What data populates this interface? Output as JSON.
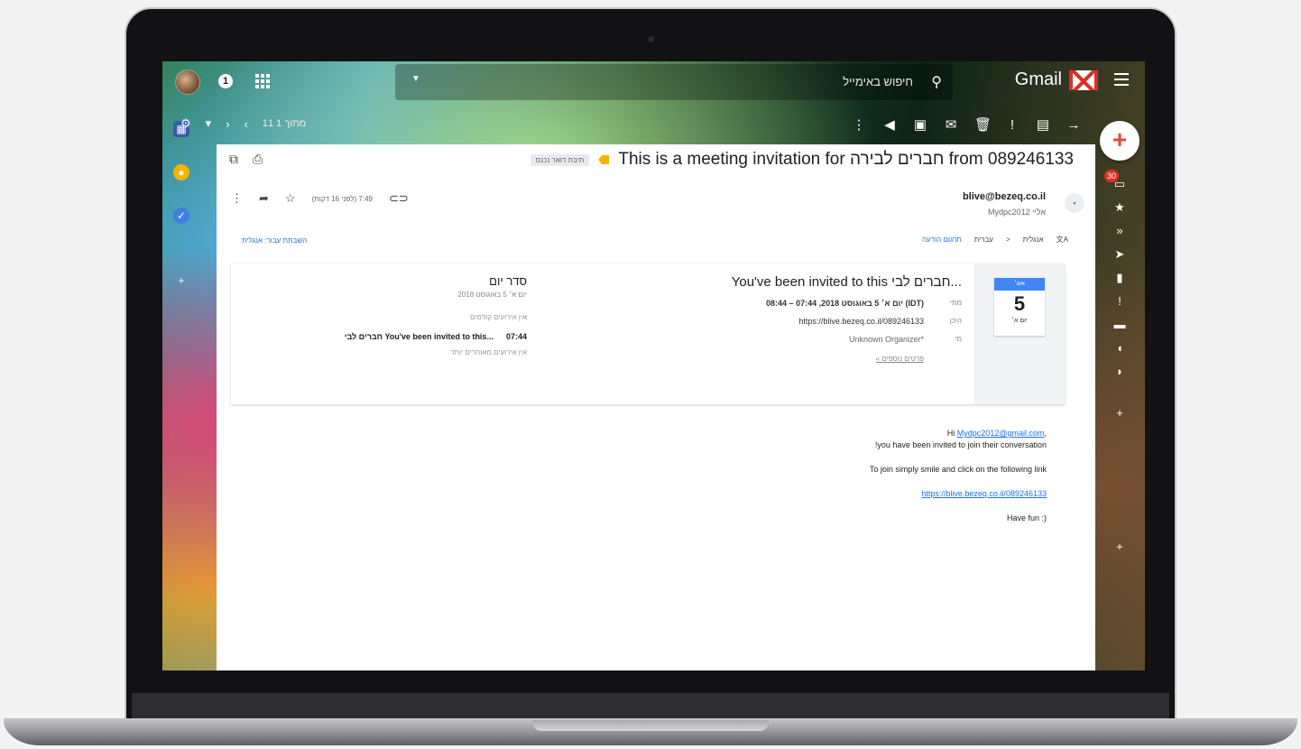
{
  "app": {
    "brand": "Gmail",
    "search_placeholder": "חיפוש באימייל",
    "notification_count": "1"
  },
  "toolbar": {
    "count_text": "11 מתוך 1"
  },
  "right_rail": {
    "inbox_badge": "30"
  },
  "email": {
    "subject": "This is a meeting invitation for חברים לבירה from 089246133",
    "label_chip": "תיבת דואר נכנס",
    "sender_email": "blive@bezeq.co.il",
    "sender_to": "אליי Mydpc2012",
    "time": "7:49 (לפני 16 דקות)",
    "translate": {
      "from_lang": "אנגלית",
      "arrow": "<",
      "to_lang": "עברית",
      "translate_link": "תרגום הודעה",
      "turn_off": "השבתת עבור: אנגלית"
    },
    "invite": {
      "cal_month": "אוג׳",
      "cal_day": "5",
      "cal_dow": "יום א׳",
      "title": "...חברים לבי You've been invited to this",
      "rows": [
        {
          "label": "מתי",
          "value": "יום א׳ 5 באוגוסט 2018, 07:44 – 08:44 (IDT)"
        },
        {
          "label": "היכן",
          "value": "https://blive.bezeq.co.il/089246133"
        },
        {
          "label": "מי",
          "value": "Unknown Organizer*"
        }
      ],
      "more": "פרטים נוספים »"
    },
    "agenda": {
      "title": "סדר יום",
      "date": "יום א׳ 5 באוגוסט 2018",
      "note_before": "אין אירועים קודמים",
      "event_time": "07:44",
      "event_title": "...You've been invited to this חברים לבי",
      "note_after": "אין אירועים מאוחרים יותר"
    },
    "body": {
      "greeting_prefix": "Hi ",
      "greeting_link": "Mydpc2012@gmail.com",
      "greeting_suffix": ",",
      "line1": "!you have been invited to join their conversation",
      "line2": "To join simply smile and click on the following link",
      "link": "https://blive.bezeq.co.il/089246133",
      "closing": "Have fun :)"
    }
  }
}
